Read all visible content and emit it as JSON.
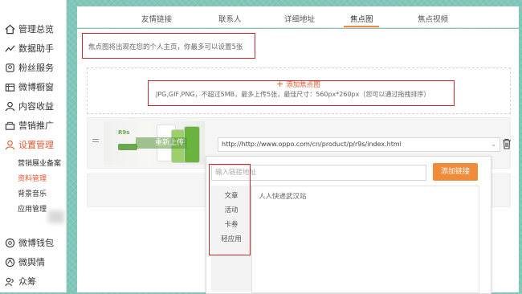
{
  "sidebar": {
    "items": [
      {
        "label": "管理总览",
        "icon": "home-icon"
      },
      {
        "label": "数据助手",
        "icon": "trend-icon"
      },
      {
        "label": "粉丝服务",
        "icon": "fans-icon"
      },
      {
        "label": "微博橱窗",
        "icon": "store-icon"
      },
      {
        "label": "内容收益",
        "icon": "person-icon"
      },
      {
        "label": "营销推广",
        "icon": "megaphone-icon"
      },
      {
        "label": "设置管理",
        "icon": "settings-person-icon"
      }
    ],
    "sub_items": [
      "营销展业备案",
      "资料管理",
      "背景音乐",
      "应用管理"
    ],
    "bottom_items": [
      {
        "label": "微博钱包",
        "icon": "wallet-icon"
      },
      {
        "label": "微舆情",
        "icon": "opinion-icon"
      },
      {
        "label": "众筹",
        "icon": "crowd-icon"
      }
    ],
    "active_item": "设置管理",
    "active_sub": "资料管理"
  },
  "tabs": [
    "友情链接",
    "联系人",
    "详细地址",
    "焦点图",
    "焦点视频"
  ],
  "active_tab": "焦点图",
  "content": {
    "notice": "焦点图将出现在您的个人主页，你最多可以设置5张",
    "add_focus": "添加焦点图",
    "spec": "JPG,GIF,PNG，不超过5MB，最多上传5张，最佳尺寸：560px*260px（您可以通过拖拽排序）",
    "reupload": "重新上传",
    "url_value": "http://http://www.oppo.com/cn/product/p/r9s/index.html",
    "link_placeholder": "输入链接地址",
    "add_link": "添加链接",
    "categories": [
      "文章",
      "活动",
      "卡券",
      "轻应用"
    ],
    "result_item": "人人快递武汉站"
  },
  "colors": {
    "accent": "#e4572e",
    "button": "#f08b3a",
    "highlight_box": "#c62828"
  }
}
